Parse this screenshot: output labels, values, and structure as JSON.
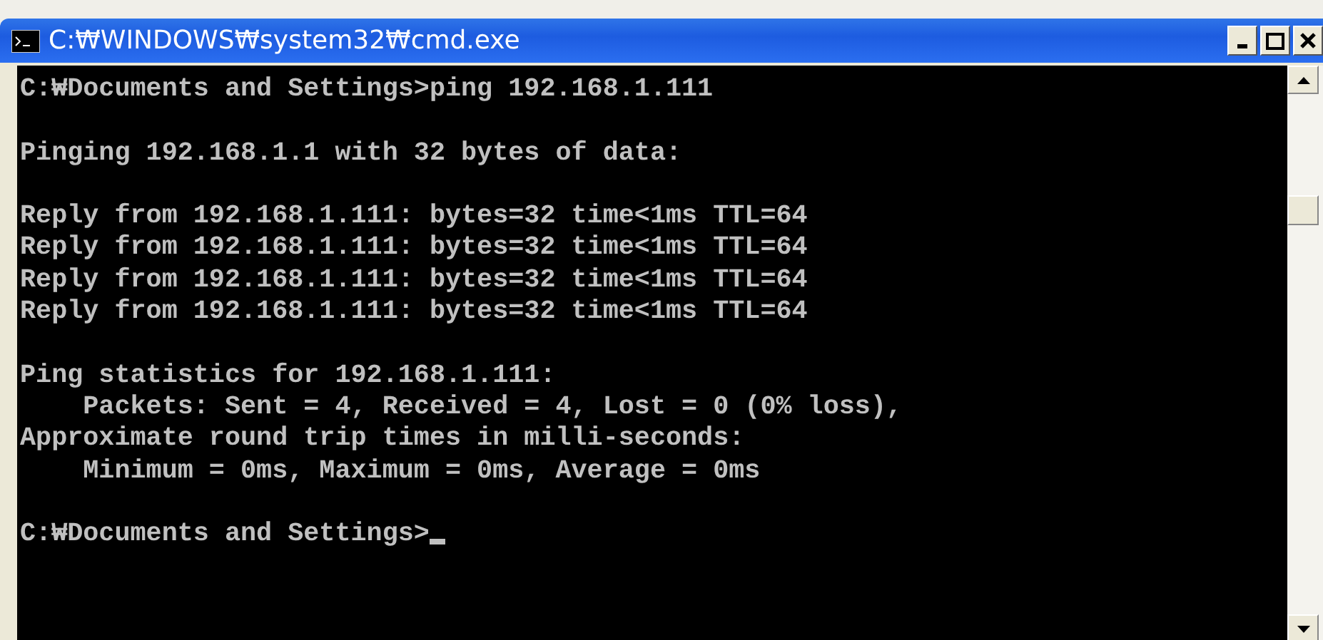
{
  "window": {
    "title": "C:₩WINDOWS₩system32₩cmd.exe"
  },
  "console": {
    "blocks": [
      [
        "C:₩Documents and Settings>ping 192.168.1.111"
      ],
      [
        "Pinging 192.168.1.1 with 32 bytes of data:"
      ],
      [
        "Reply from 192.168.1.111: bytes=32 time<1ms TTL=64",
        "Reply from 192.168.1.111: bytes=32 time<1ms TTL=64",
        "Reply from 192.168.1.111: bytes=32 time<1ms TTL=64",
        "Reply from 192.168.1.111: bytes=32 time<1ms TTL=64"
      ],
      [
        "Ping statistics for 192.168.1.111:",
        "    Packets: Sent = 4, Received = 4, Lost = 0 (0% loss),",
        "Approximate round trip times in milli-seconds:",
        "    Minimum = 0ms, Maximum = 0ms, Average = 0ms"
      ]
    ],
    "prompt": {
      "text": "C:₩Documents and Settings>",
      "cursor": true
    }
  }
}
